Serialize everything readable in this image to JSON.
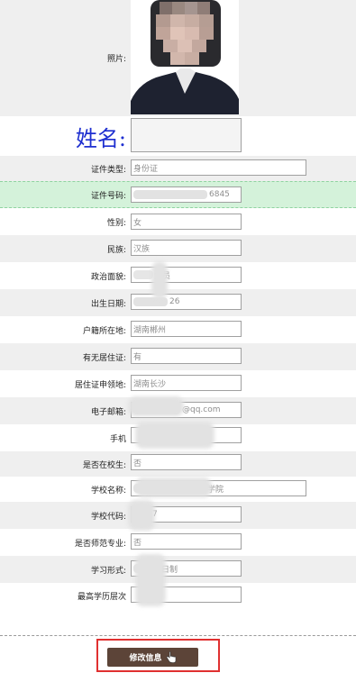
{
  "photo": {
    "label": "照片:",
    "icon": "portrait-photo"
  },
  "name": {
    "label": "姓名:",
    "value": "",
    "label_color": "#1e2fd0"
  },
  "fields": [
    {
      "label": "证件类型:",
      "value": "身份证"
    },
    {
      "label": "证件号码:",
      "value": "6845"
    },
    {
      "label": "性别:",
      "value": "女"
    },
    {
      "label": "民族:",
      "value": "汉族"
    },
    {
      "label": "政治面貌:",
      "value": "党员"
    },
    {
      "label": "出生日期:",
      "value": "26"
    },
    {
      "label": "户籍所在地:",
      "value": "湖南郴州"
    },
    {
      "label": "有无居住证:",
      "value": "有"
    },
    {
      "label": "居住证申领地:",
      "value": "湖南长沙"
    },
    {
      "label": "电子邮箱:",
      "value": "@qq.com"
    },
    {
      "label": "手机",
      "value": ""
    },
    {
      "label": "是否在校生:",
      "value": "否"
    },
    {
      "label": "学校名称:",
      "value": "学院"
    },
    {
      "label": "学校代码:",
      "value": "7"
    },
    {
      "label": "是否师范专业:",
      "value": "否"
    },
    {
      "label": "学习形式:",
      "value": "日制"
    },
    {
      "label": "最高学历层次",
      "value": ""
    }
  ],
  "action": {
    "edit_label": "修改信息",
    "button_color": "#5c4438",
    "frame_color": "#e03030"
  },
  "colors": {
    "row_shade": "#efefef",
    "row_highlight": "#d4f2da"
  }
}
